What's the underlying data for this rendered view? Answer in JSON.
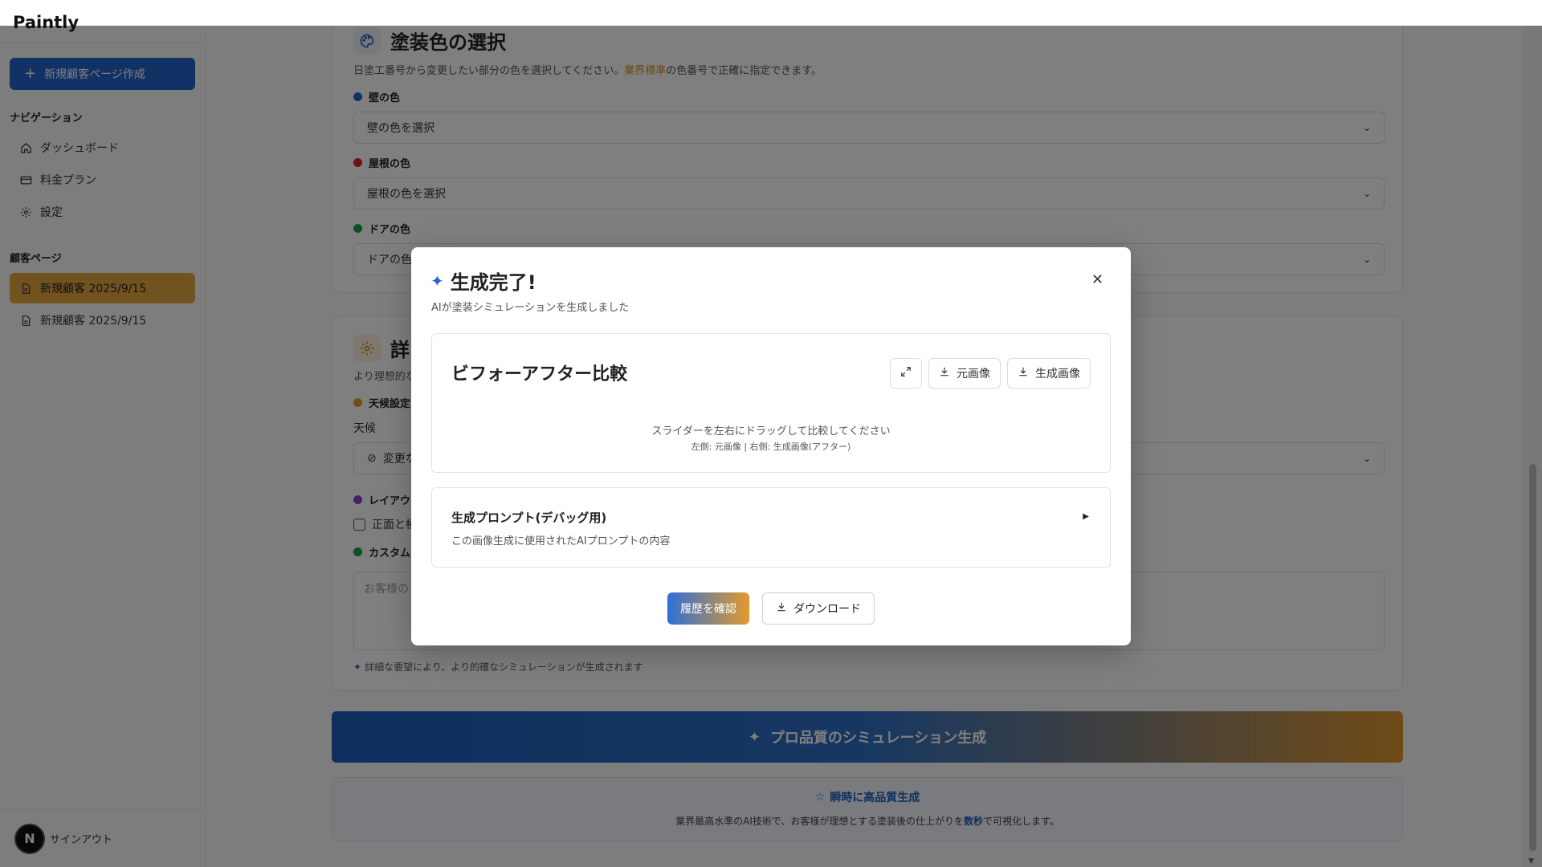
{
  "app": {
    "brand": "Paintly"
  },
  "sidebar": {
    "new_button": "新規顧客ページ作成",
    "nav_title": "ナビゲーション",
    "nav_items": [
      {
        "label": "ダッシュボード",
        "icon": "home-icon"
      },
      {
        "label": "料金プラン",
        "icon": "credit-card-icon"
      },
      {
        "label": "設定",
        "icon": "gear-icon"
      }
    ],
    "customer_title": "顧客ページ",
    "customer_items": [
      {
        "label": "新規顧客 2025/9/15",
        "active": true
      },
      {
        "label": "新規顧客 2025/9/15",
        "active": false
      }
    ],
    "user_initial": "N",
    "signout": "サインアウト"
  },
  "color_card": {
    "title": "塗装色の選択",
    "subtitle_pre": "日塗工番号から変更したい部分の色を選択してください。",
    "subtitle_hl": "業界標準",
    "subtitle_post": "の色番号で正確に指定できます。",
    "fields": [
      {
        "label": "壁の色",
        "placeholder": "壁の色を選択",
        "color": "#2563c9"
      },
      {
        "label": "屋根の色",
        "placeholder": "屋根の色を選択",
        "color": "#dc2626"
      },
      {
        "label": "ドアの色",
        "placeholder": "ドアの色を",
        "color": "#16a34a"
      }
    ]
  },
  "detail_card": {
    "title": "詳",
    "subtitle": "より理想的な",
    "weather_section": "天候設定",
    "weather_label": "天候",
    "weather_value": "変更な",
    "layout_section": "レイアウト",
    "layout_checkbox": "正面と横",
    "custom_section": "カスタム要",
    "custom_placeholder": "お客様の",
    "hint": "詳細な要望により、より的確なシミュレーションが生成されます"
  },
  "generate_button": "プロ品質のシミュレーション生成",
  "info_box": {
    "title": "瞬時に高品質生成",
    "text_pre": "業界最高水準のAI技術で、お客様が理想とする塗装後の仕上がりを",
    "text_hl": "数秒",
    "text_post": "で可視化します。"
  },
  "modal": {
    "title": "生成完了!",
    "subtitle": "AIが塗装シミュレーションを生成しました",
    "compare_title": "ビフォーアフター比較",
    "original_btn": "元画像",
    "generated_btn": "生成画像",
    "slider_hint": "スライダーを左右にドラッグして比較してください",
    "slider_sub": "左側: 元画像 | 右側: 生成画像(アフター)",
    "prompt_title": "生成プロンプト(デバッグ用)",
    "prompt_sub": "この画像生成に使用されたAIプロンプトの内容",
    "history_btn": "履歴を確認",
    "download_btn": "ダウンロード"
  },
  "colors": {
    "primary": "#2563c9",
    "accent": "#e3a640"
  }
}
